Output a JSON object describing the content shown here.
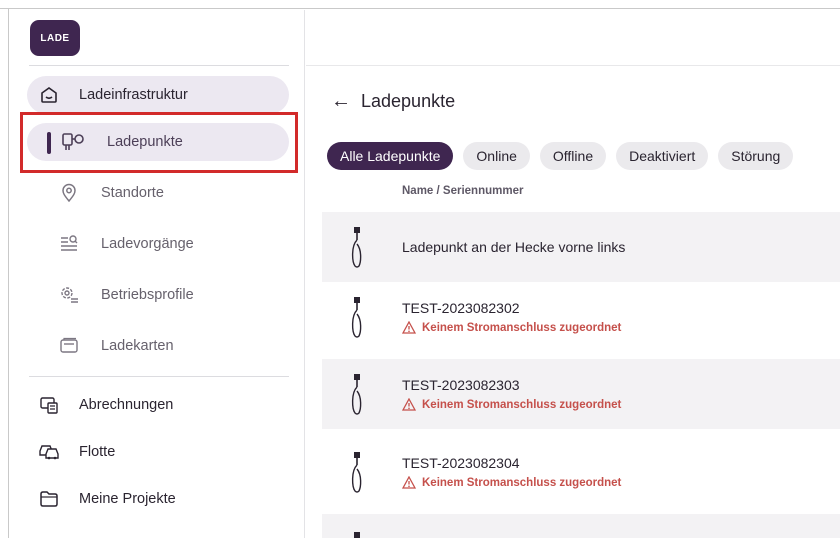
{
  "app": {
    "logo_text": "LADE"
  },
  "sidebar": {
    "parent_item": {
      "label": "Ladeinfrastruktur",
      "icon": "home-icon"
    },
    "sub_items": [
      {
        "label": "Ladepunkte",
        "icon": "charging-point-icon",
        "active": true
      },
      {
        "label": "Standorte",
        "icon": "location-pin-icon",
        "active": false
      },
      {
        "label": "Ladevorgänge",
        "icon": "list-search-icon",
        "active": false
      },
      {
        "label": "Betriebsprofile",
        "icon": "settings-list-icon",
        "active": false
      },
      {
        "label": "Ladekarten",
        "icon": "card-icon",
        "active": false
      }
    ],
    "bottom_items": [
      {
        "label": "Abrechnungen",
        "icon": "billing-icon"
      },
      {
        "label": "Flotte",
        "icon": "fleet-icon"
      },
      {
        "label": "Meine Projekte",
        "icon": "folder-icon"
      }
    ]
  },
  "main": {
    "title": "Ladepunkte",
    "back_icon": "arrow-left-icon",
    "filters": [
      {
        "label": "Alle Ladepunkte",
        "active": true
      },
      {
        "label": "Online",
        "active": false
      },
      {
        "label": "Offline",
        "active": false
      },
      {
        "label": "Deaktiviert",
        "active": false
      },
      {
        "label": "Störung",
        "active": false
      }
    ],
    "column_header": "Name / Seriennummer",
    "rows": [
      {
        "name": "Ladepunkt an der Hecke vorne links",
        "warning": ""
      },
      {
        "name": "TEST-2023082302",
        "warning": "Keinem Stromanschluss zugeordnet"
      },
      {
        "name": "TEST-2023082303",
        "warning": "Keinem Stromanschluss zugeordnet"
      },
      {
        "name": "TEST-2023082304",
        "warning": "Keinem Stromanschluss zugeordnet"
      },
      {
        "name": "",
        "warning": ""
      }
    ]
  },
  "colors": {
    "brand": "#3f2650",
    "active_bg": "#ece8f1",
    "warning": "#c5504b",
    "highlight": "#d22a2a"
  }
}
